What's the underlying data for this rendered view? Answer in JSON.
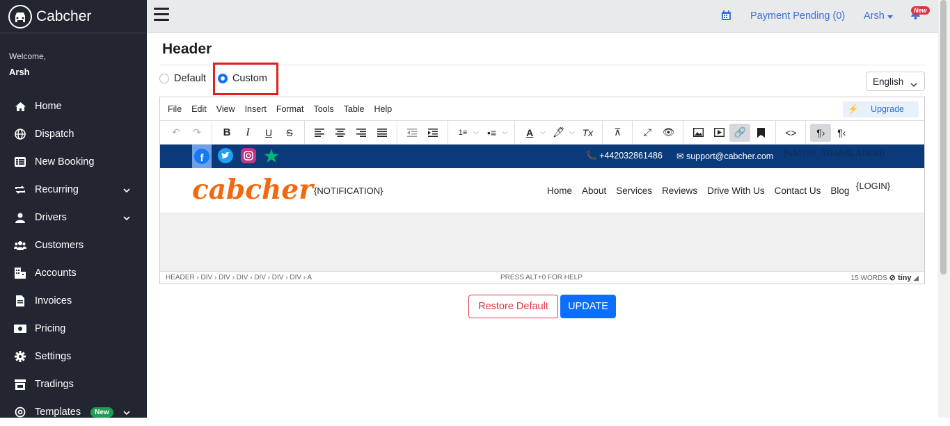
{
  "sidebar": {
    "brand": "Cabcher",
    "welcome": "Welcome,",
    "user": "Arsh",
    "items": [
      {
        "label": "Home"
      },
      {
        "label": "Dispatch"
      },
      {
        "label": "New Booking"
      },
      {
        "label": "Recurring"
      },
      {
        "label": "Drivers"
      },
      {
        "label": "Customers"
      },
      {
        "label": "Accounts"
      },
      {
        "label": "Invoices"
      },
      {
        "label": "Pricing"
      },
      {
        "label": "Settings"
      },
      {
        "label": "Tradings"
      },
      {
        "label": "Templates",
        "badge": "New"
      }
    ]
  },
  "topbar": {
    "payment": "Payment Pending (0)",
    "user": "Arsh",
    "bell_badge": "New"
  },
  "page": {
    "title": "Header",
    "radio_default": "Default",
    "radio_custom": "Custom",
    "language": "English"
  },
  "editor": {
    "menu": [
      "File",
      "Edit",
      "View",
      "Insert",
      "Format",
      "Tools",
      "Table",
      "Help"
    ],
    "upgrade": "Upgrade",
    "preview": {
      "phone": "+442032861486",
      "email": "support@cabcher.com",
      "native": "{NATIVE_TRANSLATION}",
      "logo": "cabcher",
      "notification": "{NOTIFICATION}",
      "links": [
        "Home",
        "About",
        "Services",
        "Reviews",
        "Drive With Us",
        "Contact Us",
        "Blog"
      ],
      "login": "{LOGIN}"
    },
    "status_path": "HEADER › DIV › DIV › DIV › DIV › DIV › DIV › A",
    "status_help": "PRESS ALT+0 FOR HELP",
    "status_words": "15 WORDS",
    "status_brand": "tiny"
  },
  "buttons": {
    "restore": "Restore Default",
    "update": "UPDATE"
  },
  "colors": {
    "sidebar_bg": "#212631",
    "accent": "#0d6efd",
    "preview_bar": "#0b3a7a",
    "logo": "#f26a10"
  }
}
